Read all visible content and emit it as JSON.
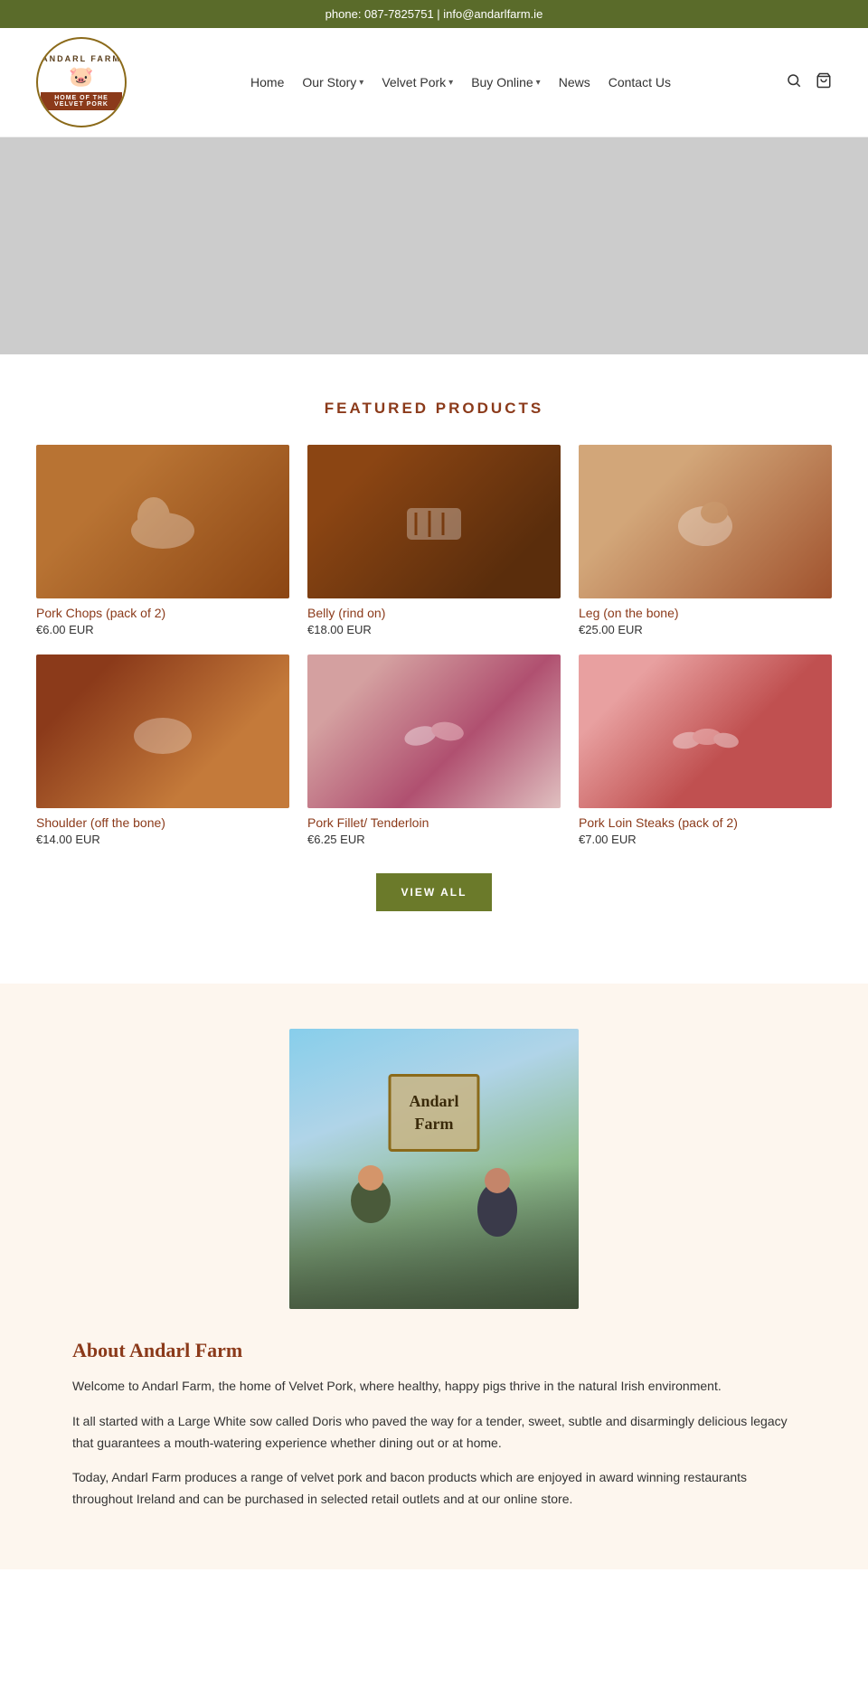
{
  "topbar": {
    "text": "phone: 087-7825751 | info@andarlfarm.ie"
  },
  "header": {
    "logo": {
      "name_top": "ANDARL FARM",
      "banner": "HOME OF THE VELVET PORK",
      "pig_emoji": "🐷"
    },
    "nav": {
      "home": "Home",
      "our_story": "Our Story",
      "velvet_pork": "Velvet Pork",
      "buy_online": "Buy Online",
      "news": "News",
      "contact_us": "Contact Us"
    },
    "search_icon": "🔍",
    "cart_icon": "🛒"
  },
  "featured": {
    "section_title": "FEATURED PRODUCTS",
    "products": [
      {
        "id": 1,
        "name": "Pork Chops (pack of 2)",
        "price": "€6.00 EUR",
        "img_class": "p1"
      },
      {
        "id": 2,
        "name": "Belly (rind on)",
        "price": "€18.00 EUR",
        "img_class": "p2"
      },
      {
        "id": 3,
        "name": "Leg (on the bone)",
        "price": "€25.00 EUR",
        "img_class": "p3"
      },
      {
        "id": 4,
        "name": "Shoulder (off the bone)",
        "price": "€14.00 EUR",
        "img_class": "p4"
      },
      {
        "id": 5,
        "name": "Pork Fillet/ Tenderloin",
        "price": "€6.25 EUR",
        "img_class": "p5"
      },
      {
        "id": 6,
        "name": "Pork Loin Steaks (pack of 2)",
        "price": "€7.00 EUR",
        "img_class": "p6"
      }
    ],
    "view_all_btn": "VIEW ALL"
  },
  "about": {
    "title": "About Andarl Farm",
    "farm_sign_line1": "Andarl",
    "farm_sign_line2": "Farm",
    "para1": "Welcome to Andarl Farm, the home of Velvet Pork, where healthy, happy pigs thrive in the natural Irish environment.",
    "para2": "It all started with a Large White sow called Doris who paved the way for a tender, sweet, subtle and disarmingly delicious legacy that guarantees a mouth-watering experience whether dining out or at home.",
    "para3": "Today, Andarl Farm produces a range of velvet pork and bacon products which are enjoyed in award winning restaurants throughout Ireland and can be purchased in selected retail outlets and at our online store."
  }
}
